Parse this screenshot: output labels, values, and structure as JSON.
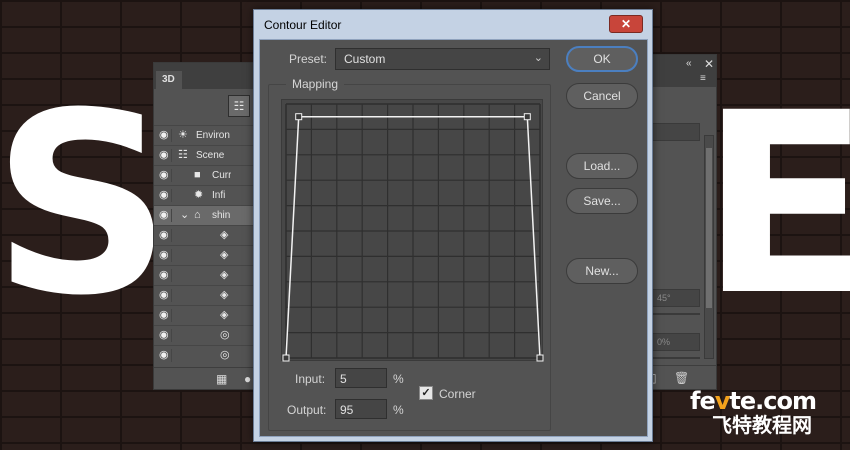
{
  "background": {
    "letters": [
      "S",
      "E"
    ]
  },
  "panel_3d": {
    "tab_label": "3D",
    "layers": [
      {
        "name": "Environ",
        "icon": "environment-icon"
      },
      {
        "name": "Scene",
        "icon": "scene-icon"
      },
      {
        "name": "Curr",
        "icon": "camera-icon"
      },
      {
        "name": "Infi",
        "icon": "infinite-light-icon"
      },
      {
        "name": "shin",
        "icon": "mesh-icon"
      },
      {
        "name": "",
        "icon": "material-icon"
      },
      {
        "name": "",
        "icon": "material-icon"
      },
      {
        "name": "",
        "icon": "material-icon"
      },
      {
        "name": "",
        "icon": "material-icon"
      },
      {
        "name": "",
        "icon": "material-icon"
      },
      {
        "name": "",
        "icon": "constraint-icon"
      },
      {
        "name": "",
        "icon": "constraint-icon"
      }
    ]
  },
  "properties_panel": {
    "angle_value": "45°",
    "percent_value": "0%"
  },
  "dialog": {
    "title": "Contour Editor",
    "close_label": "✕",
    "preset_label": "Preset:",
    "preset_value": "Custom",
    "mapping_label": "Mapping",
    "input_label": "Input:",
    "input_value": "5",
    "output_label": "Output:",
    "output_value": "95",
    "percent_sign": "%",
    "corner_label": "Corner",
    "corner_checked": true,
    "buttons": {
      "ok": "OK",
      "cancel": "Cancel",
      "load": "Load...",
      "save": "Save...",
      "new": "New..."
    },
    "curve_points": [
      {
        "input": 0,
        "output": 0
      },
      {
        "input": 5,
        "output": 95
      },
      {
        "input": 95,
        "output": 95
      },
      {
        "input": 100,
        "output": 0
      }
    ]
  },
  "watermark": {
    "line1_a": "fe",
    "line1_b": "v",
    "line1_c": "te.com",
    "line2": "飞特教程网"
  }
}
